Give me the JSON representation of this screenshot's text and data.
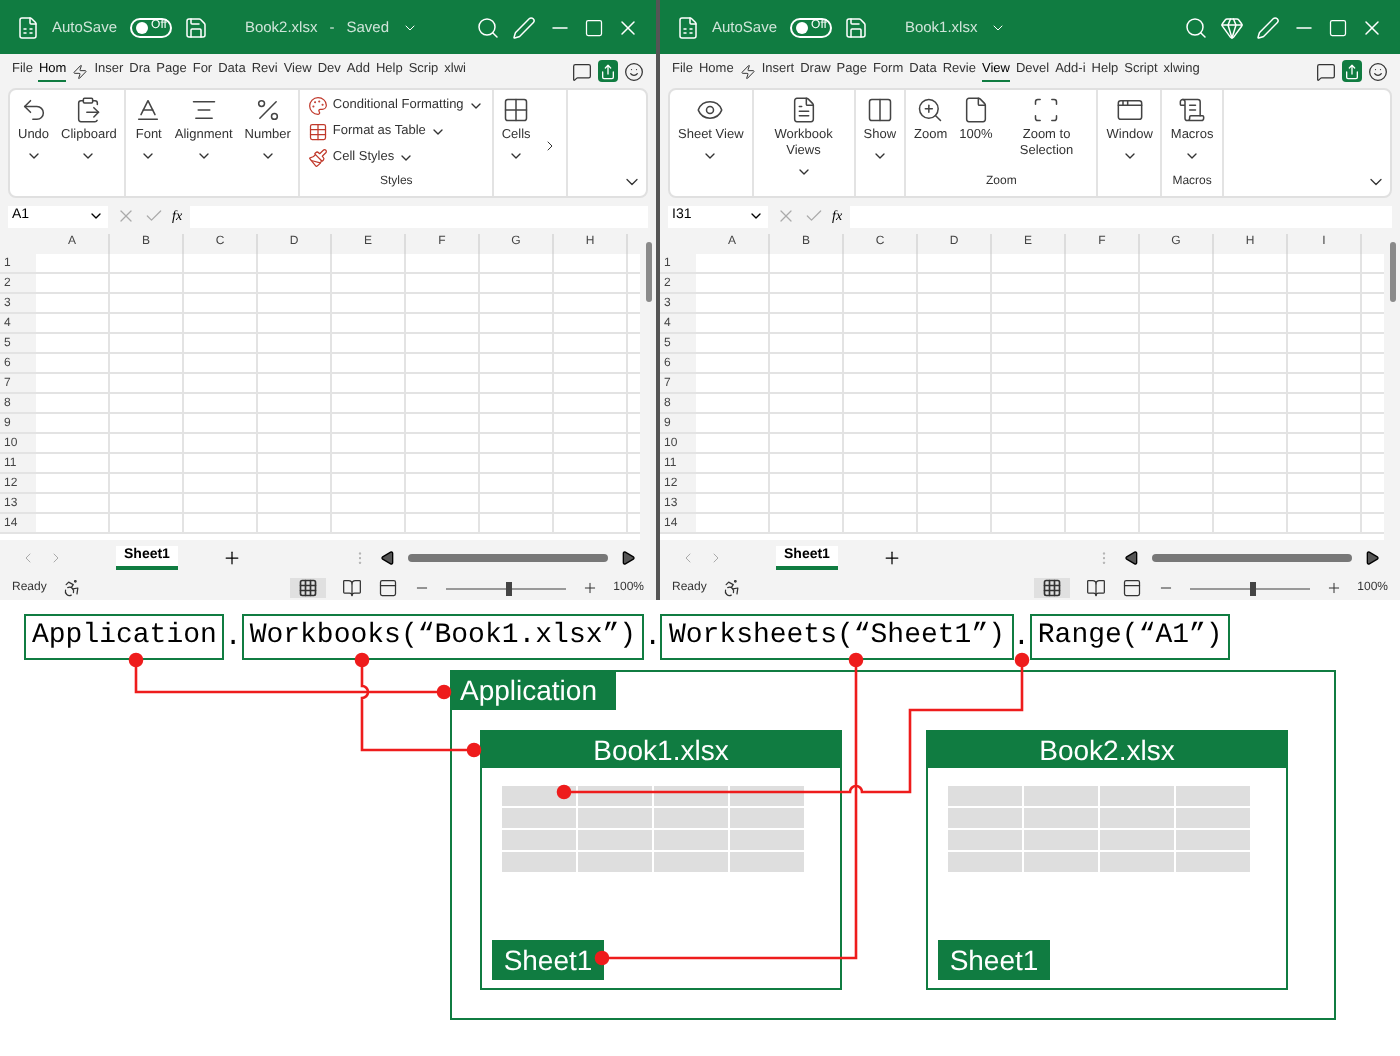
{
  "windows": [
    {
      "title": "Book2.xlsx",
      "title_separator": "-",
      "save_status": "Saved",
      "autosave": {
        "label": "AutoSave",
        "state_text": "Off",
        "on": false
      },
      "tabs": [
        {
          "label": "File",
          "selected": false
        },
        {
          "label": "Hom",
          "selected": true
        },
        {
          "label": "Inser",
          "selected": false
        },
        {
          "label": "Dra",
          "selected": false
        },
        {
          "label": "Page",
          "selected": false
        },
        {
          "label": "For",
          "selected": false
        },
        {
          "label": "Data",
          "selected": false
        },
        {
          "label": "Revi",
          "selected": false
        },
        {
          "label": "View",
          "selected": false
        },
        {
          "label": "Dev",
          "selected": false
        },
        {
          "label": "Add",
          "selected": false
        },
        {
          "label": "Help",
          "selected": false
        },
        {
          "label": "Scrip",
          "selected": false
        },
        {
          "label": "xlwi",
          "selected": false
        }
      ],
      "ribbon": [
        {
          "items": [
            {
              "kind": "large",
              "label": "Undo",
              "dropdown": true
            },
            {
              "kind": "large",
              "label": "Clipboard",
              "dropdown": true
            }
          ]
        },
        {
          "items": [
            {
              "kind": "large",
              "label": "Font",
              "dropdown": true
            },
            {
              "kind": "large",
              "label": "Alignment",
              "dropdown": true
            },
            {
              "kind": "large",
              "label": "Number",
              "dropdown": true
            }
          ]
        },
        {
          "label": "Styles",
          "items": [
            {
              "kind": "small",
              "label": "Conditional Formatting",
              "dropdown": true
            },
            {
              "kind": "small",
              "label": "Format as Table",
              "dropdown": true
            },
            {
              "kind": "small",
              "label": "Cell Styles",
              "dropdown": true
            }
          ]
        },
        {
          "items": [
            {
              "kind": "large",
              "label": "Cells",
              "dropdown": true
            }
          ]
        }
      ],
      "name_box": "A1",
      "fx": "fx",
      "columns": [
        "A",
        "B",
        "C",
        "D",
        "E",
        "F",
        "G",
        "H"
      ],
      "rows": [
        "1",
        "2",
        "3",
        "4",
        "5",
        "6",
        "7",
        "8",
        "9",
        "10",
        "11",
        "12",
        "13",
        "14"
      ],
      "sheet_tabs": [
        {
          "label": "Sheet1",
          "selected": true
        }
      ],
      "status": "Ready",
      "zoom": {
        "level": 0.5,
        "reading": "100%"
      }
    },
    {
      "title": "Book1.xlsx",
      "autosave": {
        "label": "AutoSave",
        "state_text": "Off",
        "on": false
      },
      "tabs": [
        {
          "label": "File",
          "selected": false
        },
        {
          "label": "Home",
          "selected": false
        },
        {
          "label": "Insert",
          "selected": false
        },
        {
          "label": "Draw",
          "selected": false
        },
        {
          "label": "Page",
          "selected": false
        },
        {
          "label": "Form",
          "selected": false
        },
        {
          "label": "Data",
          "selected": false
        },
        {
          "label": "Revie",
          "selected": false
        },
        {
          "label": "View",
          "selected": true
        },
        {
          "label": "Devel",
          "selected": false
        },
        {
          "label": "Add-i",
          "selected": false
        },
        {
          "label": "Help",
          "selected": false
        },
        {
          "label": "Script",
          "selected": false
        },
        {
          "label": "xlwing",
          "selected": false
        }
      ],
      "ribbon": [
        {
          "items": [
            {
              "kind": "large",
              "label": "Sheet View",
              "dropdown": true
            }
          ]
        },
        {
          "items": [
            {
              "kind": "large",
              "label": "Workbook Views",
              "dropdown": true
            }
          ]
        },
        {
          "items": [
            {
              "kind": "large",
              "label": "Show",
              "dropdown": true
            }
          ]
        },
        {
          "label": "Zoom",
          "items": [
            {
              "kind": "large",
              "label": "Zoom",
              "dropdown": false
            },
            {
              "kind": "large",
              "label": "100%",
              "dropdown": false
            },
            {
              "kind": "large",
              "label": "Zoom to Selection",
              "dropdown": false
            }
          ]
        },
        {
          "items": [
            {
              "kind": "large",
              "label": "Window",
              "dropdown": true
            }
          ]
        },
        {
          "label": "Macros",
          "items": [
            {
              "kind": "large",
              "label": "Macros",
              "dropdown": true
            }
          ]
        }
      ],
      "name_box": "I31",
      "fx": "fx",
      "columns": [
        "A",
        "B",
        "C",
        "D",
        "E",
        "F",
        "G",
        "H",
        "I"
      ],
      "rows": [
        "1",
        "2",
        "3",
        "4",
        "5",
        "6",
        "7",
        "8",
        "9",
        "10",
        "11",
        "12",
        "13",
        "14"
      ],
      "sheet_tabs": [
        {
          "label": "Sheet1",
          "selected": true
        }
      ],
      "status": "Ready",
      "zoom": {
        "level": 0.5,
        "reading": "100%"
      }
    }
  ],
  "expression": [
    {
      "kind": "token",
      "text": "Application"
    },
    {
      "kind": "separator",
      "text": "."
    },
    {
      "kind": "token",
      "text": "Workbooks(“Book1.xlsx”)"
    },
    {
      "kind": "separator",
      "text": "."
    },
    {
      "kind": "token",
      "text": "Worksheets(“Sheet1”)"
    },
    {
      "kind": "separator",
      "text": "."
    },
    {
      "kind": "token",
      "text": "Range(“A1”)"
    }
  ],
  "diagram": {
    "application_label": "Application",
    "workbooks": [
      {
        "title": "Book1.xlsx",
        "sheet": "Sheet1"
      },
      {
        "title": "Book2.xlsx",
        "sheet": "Sheet1"
      }
    ]
  }
}
